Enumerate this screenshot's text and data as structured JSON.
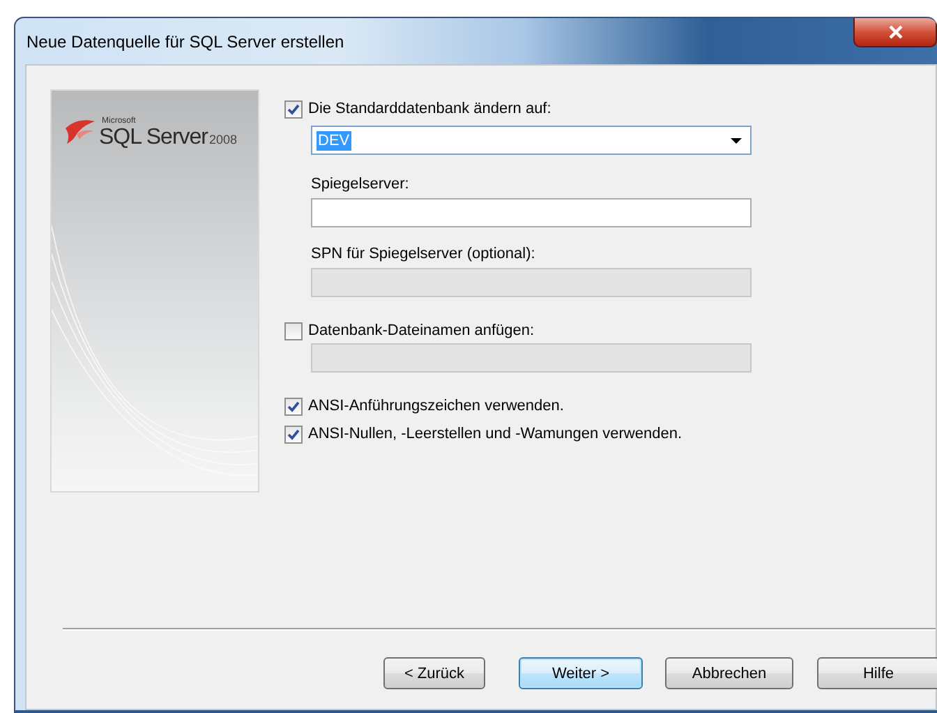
{
  "window": {
    "title": "Neue Datenquelle für SQL Server erstellen"
  },
  "logo": {
    "brand": "Microsoft",
    "product": "SQL Server",
    "version": "2008"
  },
  "options": [
    {
      "kind": "checkbox",
      "label": "Die Standarddatenbank ändern auf:",
      "checked": true
    },
    {
      "kind": "combobox",
      "value": "DEV",
      "highlighted": true
    },
    {
      "kind": "label",
      "label": "Spiegelserver:"
    },
    {
      "kind": "field",
      "disabled": false
    },
    {
      "kind": "label",
      "label": "SPN für Spiegelserver (optional):"
    },
    {
      "kind": "field",
      "disabled": true
    },
    {
      "kind": "checkbox",
      "label": "Datenbank-Dateinamen anfügen:",
      "checked": false
    },
    {
      "kind": "field",
      "disabled": true
    },
    {
      "kind": "checkbox",
      "label": "ANSI-Anführungszeichen verwenden.",
      "checked": true
    },
    {
      "kind": "checkbox",
      "label": "ANSI-Nullen, -Leerstellen und -Wamungen verwenden.",
      "checked": true
    }
  ],
  "buttons": [
    {
      "label": "< Zurück",
      "default": false
    },
    {
      "label": "Weiter >",
      "default": true
    },
    {
      "label": "Abbrechen",
      "default": false
    },
    {
      "label": "Hilfe",
      "default": false
    }
  ]
}
